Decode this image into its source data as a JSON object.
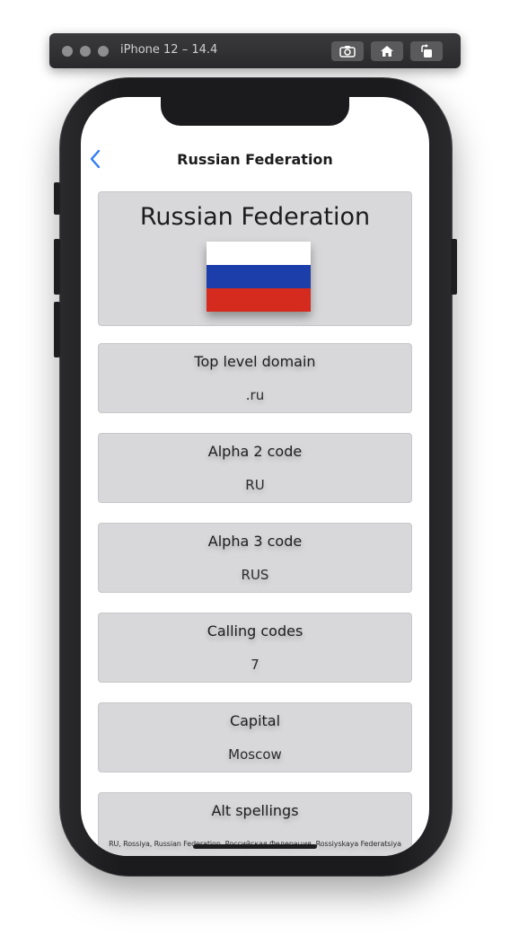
{
  "simulator": {
    "device_title": "iPhone 12 – 14.4",
    "icons": [
      "screenshot-icon",
      "home-icon",
      "rotate-icon"
    ]
  },
  "nav": {
    "title": "Russian Federation",
    "back_icon": "chevron-left-icon",
    "accent_color": "#2f7cf6"
  },
  "country": {
    "name": "Russian Federation",
    "flag_colors": [
      "#ffffff",
      "#1c3eaa",
      "#d52b1e"
    ]
  },
  "details": [
    {
      "label": "Top level domain",
      "value": ".ru"
    },
    {
      "label": "Alpha 2 code",
      "value": "RU"
    },
    {
      "label": "Alpha 3 code",
      "value": "RUS"
    },
    {
      "label": "Calling codes",
      "value": "7"
    },
    {
      "label": "Capital",
      "value": "Moscow"
    },
    {
      "label": "Alt spellings",
      "value": "RU, Rossiya, Russian Federation, Российская Федерация, Rossiyskaya Federatsiya"
    }
  ]
}
